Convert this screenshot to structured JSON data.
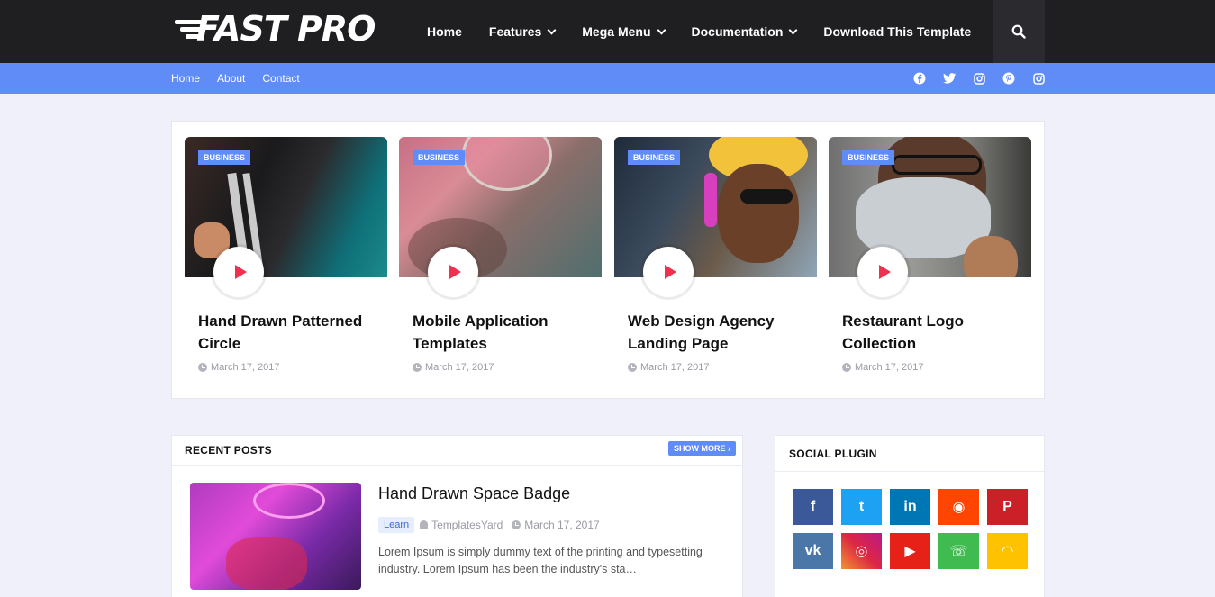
{
  "header": {
    "logo_text": "FAST PRO",
    "nav": [
      {
        "label": "Home",
        "dropdown": false
      },
      {
        "label": "Features",
        "dropdown": true
      },
      {
        "label": "Mega Menu",
        "dropdown": true
      },
      {
        "label": "Documentation",
        "dropdown": true
      },
      {
        "label": "Download This Template",
        "dropdown": false
      }
    ]
  },
  "subnav": {
    "links": [
      "Home",
      "About",
      "Contact"
    ],
    "social_icons": [
      "facebook-icon",
      "twitter-icon",
      "instagram-icon",
      "pinterest-icon",
      "instagram-icon"
    ]
  },
  "featured": [
    {
      "badge": "BUSINESS",
      "title": "Hand Drawn Patterned Circle",
      "date": "March 17, 2017"
    },
    {
      "badge": "BUSINESS",
      "title": "Mobile Application Templates",
      "date": "March 17, 2017"
    },
    {
      "badge": "BUSINESS",
      "title": "Web Design Agency Landing Page",
      "date": "March 17, 2017"
    },
    {
      "badge": "BUSINESS",
      "title": "Restaurant Logo Collection",
      "date": "March 17, 2017"
    }
  ],
  "recent_posts": {
    "title": "RECENT POSTS",
    "show_more": "SHOW MORE",
    "post": {
      "title": "Hand Drawn Space Badge",
      "tag": "Learn",
      "author": "TemplatesYard",
      "date": "March 17, 2017",
      "excerpt": "Lorem Ipsum is simply dummy text of the printing and typesetting industry. Lorem Ipsum has been the industry's sta…"
    }
  },
  "social_plugin": {
    "title": "SOCIAL PLUGIN",
    "buttons": [
      {
        "icon": "facebook-icon",
        "glyph": "f",
        "color": "#3b5998"
      },
      {
        "icon": "twitter-icon",
        "glyph": "t",
        "color": "#1da1f2"
      },
      {
        "icon": "linkedin-icon",
        "glyph": "in",
        "color": "#0077b5"
      },
      {
        "icon": "reddit-icon",
        "glyph": "◉",
        "color": "#ff4500"
      },
      {
        "icon": "pinterest-icon",
        "glyph": "P",
        "color": "#cb2027"
      },
      {
        "icon": "vk-icon",
        "glyph": "vk",
        "color": "#4a76a8"
      },
      {
        "icon": "instagram-icon",
        "glyph": "◎",
        "color": "#c13584"
      },
      {
        "icon": "youtube-icon",
        "glyph": "▶",
        "color": "#e62117"
      },
      {
        "icon": "whatsapp-icon",
        "glyph": "☏",
        "color": "#3fbb50"
      },
      {
        "icon": "rss-icon",
        "glyph": "◠",
        "color": "#ffc200"
      }
    ]
  },
  "colors": {
    "accent": "#5f8cf7",
    "header_bg": "#1f1f22",
    "play": "#f0304e"
  }
}
